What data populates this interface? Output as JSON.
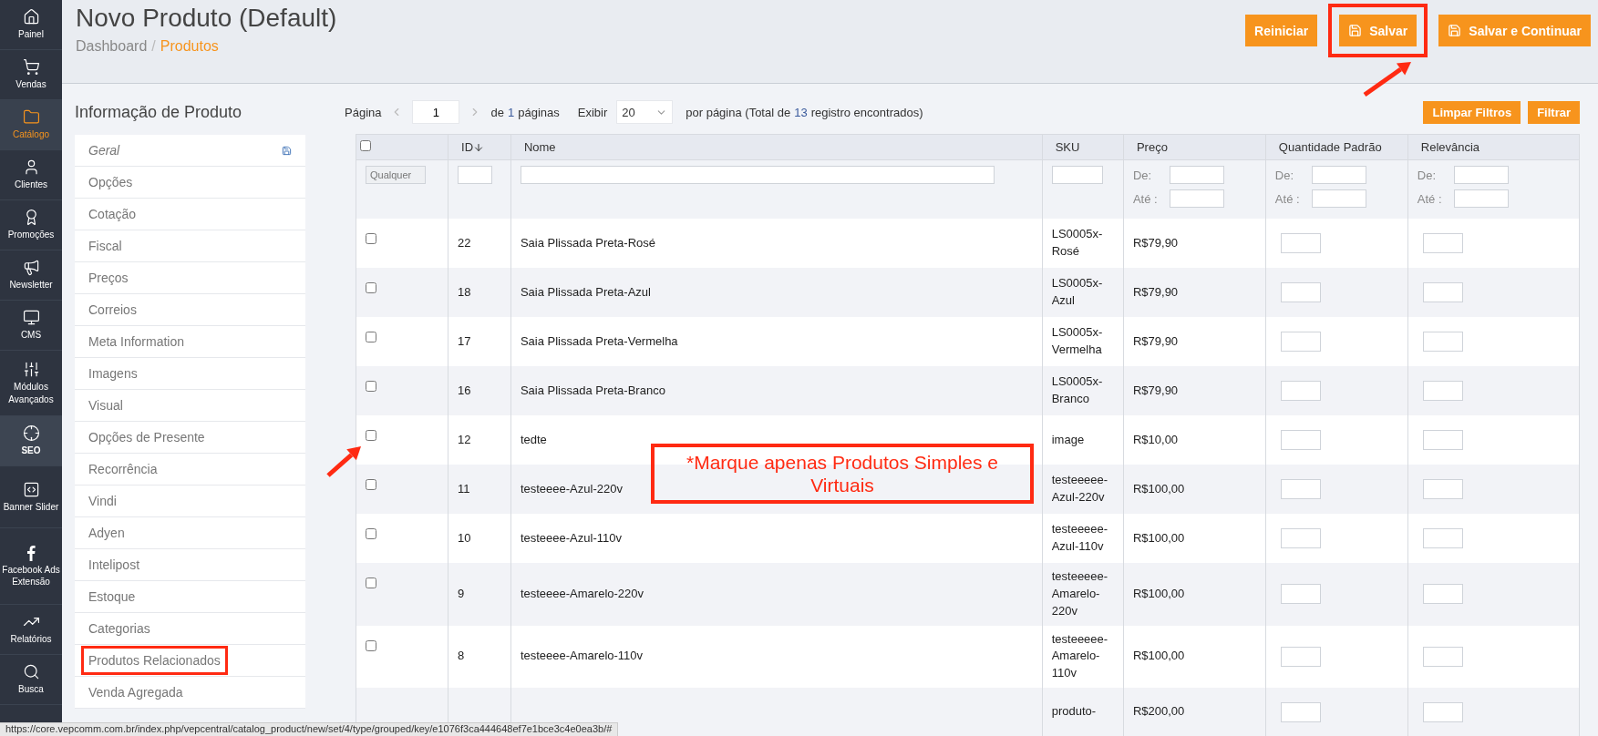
{
  "nav": [
    {
      "label": "Painel",
      "selected": false,
      "highlighted": false
    },
    {
      "label": "Vendas",
      "selected": false,
      "highlighted": false
    },
    {
      "label": "Catálogo",
      "selected": true,
      "highlighted": false
    },
    {
      "label": "Clientes",
      "selected": false,
      "highlighted": false
    },
    {
      "label": "Promoções",
      "selected": false,
      "highlighted": false
    },
    {
      "label": "Newsletter",
      "selected": false,
      "highlighted": false
    },
    {
      "label": "CMS",
      "selected": false,
      "highlighted": false
    },
    {
      "label": "Módulos Avançados",
      "selected": false,
      "highlighted": false
    },
    {
      "label": "SEO",
      "selected": false,
      "highlighted": true
    },
    {
      "label": "Banner Slider",
      "selected": false,
      "highlighted": false
    },
    {
      "label": "Facebook Ads Extensão",
      "selected": false,
      "highlighted": false
    },
    {
      "label": "Relatórios",
      "selected": false,
      "highlighted": false
    },
    {
      "label": "Busca",
      "selected": false,
      "highlighted": false
    }
  ],
  "header": {
    "title": "Novo Produto (Default)",
    "breadcrumb_separator": "/",
    "breadcrumb": [
      {
        "label": "Dashboard",
        "selected": false
      },
      {
        "label": "Produtos",
        "selected": true
      }
    ],
    "buttons": [
      {
        "label": "Reiniciar",
        "kind": "plain",
        "highlighted": false
      },
      {
        "label": "Salvar",
        "kind": "save",
        "highlighted": true
      },
      {
        "label": "Salvar e Continuar",
        "kind": "save",
        "highlighted": false
      }
    ]
  },
  "product_info": {
    "title": "Informação de Produto",
    "items": [
      {
        "label": "Geral",
        "selected": true,
        "highlighted": false
      },
      {
        "label": "Opções",
        "selected": false,
        "highlighted": false
      },
      {
        "label": "Cotação",
        "selected": false,
        "highlighted": false
      },
      {
        "label": "Fiscal",
        "selected": false,
        "highlighted": false
      },
      {
        "label": "Preços",
        "selected": false,
        "highlighted": false
      },
      {
        "label": "Correios",
        "selected": false,
        "highlighted": false
      },
      {
        "label": "Meta Information",
        "selected": false,
        "highlighted": false
      },
      {
        "label": "Imagens",
        "selected": false,
        "highlighted": false
      },
      {
        "label": "Visual",
        "selected": false,
        "highlighted": false
      },
      {
        "label": "Opções de Presente",
        "selected": false,
        "highlighted": false
      },
      {
        "label": "Recorrência",
        "selected": false,
        "highlighted": false
      },
      {
        "label": "Vindi",
        "selected": false,
        "highlighted": false
      },
      {
        "label": "Adyen",
        "selected": false,
        "highlighted": false
      },
      {
        "label": "Intelipost",
        "selected": false,
        "highlighted": false
      },
      {
        "label": "Estoque",
        "selected": false,
        "highlighted": false
      },
      {
        "label": "Categorias",
        "selected": false,
        "highlighted": false
      },
      {
        "label": "Produtos Relacionados",
        "selected": false,
        "highlighted": true
      },
      {
        "label": "Venda Agregada",
        "selected": false,
        "highlighted": false
      }
    ]
  },
  "pager": {
    "label": "Página",
    "page": "1",
    "of_prefix": "de",
    "total_pages": "1",
    "of_suffix": "páginas",
    "show_label": "Exibir",
    "per_page": "20",
    "per_page_prefix": "por página (Total de",
    "total_records": "13",
    "total_suffix": "registro encontrados)"
  },
  "filter_buttons": [
    "Limpar Filtros",
    "Filtrar"
  ],
  "table": {
    "select_all_checked": false,
    "columns": [
      "ID",
      "Nome",
      "SKU",
      "Preço",
      "Quantidade Padrão",
      "Relevância"
    ],
    "filters": {
      "select": "Qualquer",
      "ranges": [
        {
          "from_label": "De:",
          "to_label": "Até :"
        },
        {
          "from_label": "De:",
          "to_label": "Até :"
        },
        {
          "from_label": "De:",
          "to_label": "Até :"
        }
      ]
    },
    "rows": [
      {
        "checked": false,
        "id": "22",
        "name": "Saia Plissada Preta-Rosé",
        "sku": "LS0005x-Rosé",
        "price": "R$79,90"
      },
      {
        "checked": false,
        "id": "18",
        "name": "Saia Plissada Preta-Azul",
        "sku": "LS0005x-Azul",
        "price": "R$79,90"
      },
      {
        "checked": false,
        "id": "17",
        "name": "Saia Plissada Preta-Vermelha",
        "sku": "LS0005x-Vermelha",
        "price": "R$79,90"
      },
      {
        "checked": false,
        "id": "16",
        "name": "Saia Plissada Preta-Branco",
        "sku": "LS0005x-Branco",
        "price": "R$79,90"
      },
      {
        "checked": false,
        "id": "12",
        "name": "tedte",
        "sku": "image",
        "price": "R$10,00"
      },
      {
        "checked": false,
        "id": "11",
        "name": "testeeee-Azul-220v",
        "sku": "testeeeee-Azul-220v",
        "price": "R$100,00"
      },
      {
        "checked": false,
        "id": "10",
        "name": "testeeee-Azul-110v",
        "sku": "testeeeee-Azul-110v",
        "price": "R$100,00"
      },
      {
        "checked": false,
        "id": "9",
        "name": "testeeee-Amarelo-220v",
        "sku": "testeeeee-Amarelo-220v",
        "price": "R$100,00"
      },
      {
        "checked": false,
        "id": "8",
        "name": "testeeee-Amarelo-110v",
        "sku": "testeeeee-Amarelo-110v",
        "price": "R$100,00"
      },
      {
        "sku": "produto-",
        "price": "R$200,00"
      }
    ]
  },
  "note": "*Marque apenas Produtos Simples e Virtuais",
  "status_bar": "https://core.vepcomm.com.br/index.php/vepcentral/catalog_product/new/set/4/type/grouped/key/e1076f3ca444648ef7e1bce3c4e0ea3b/#"
}
